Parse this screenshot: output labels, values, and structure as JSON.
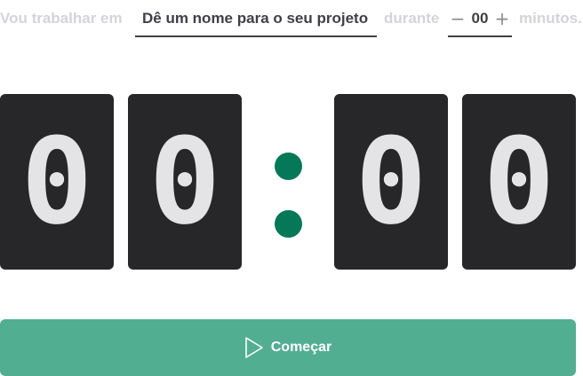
{
  "task_form": {
    "lead_text": "Vou trabalhar em",
    "project_placeholder": "Dê um nome para o seu projeto",
    "project_value": "",
    "during_text": "durante",
    "minutes_value": "00",
    "decrement_symbol": "−",
    "increment_symbol": "+",
    "minutes_text": "minutos."
  },
  "timer": {
    "minute_digits": [
      "0",
      "0"
    ],
    "second_digits": [
      "0",
      "0"
    ],
    "colon_color": "#047857"
  },
  "actions": {
    "start_label": "Começar",
    "start_icon": "play-icon",
    "button_color": "#52ae91"
  }
}
